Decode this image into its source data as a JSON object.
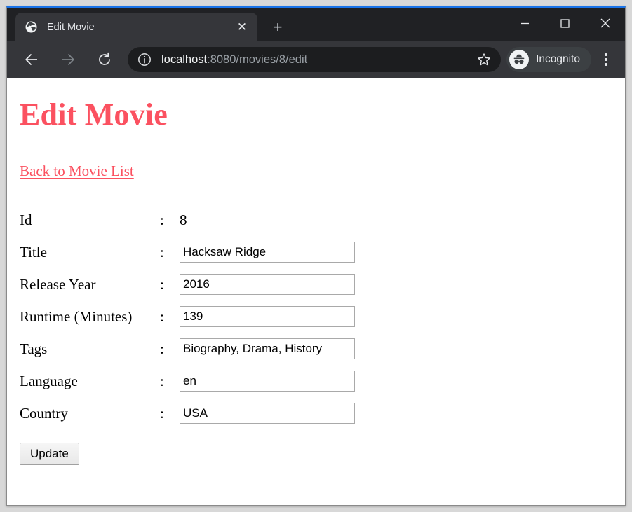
{
  "browser": {
    "tab": {
      "title": "Edit Movie",
      "favicon": "globe-icon",
      "close_label": "✕"
    },
    "new_tab_label": "+",
    "window_controls": {
      "minimize": "minimize-icon",
      "maximize": "maximize-icon",
      "close": "close-icon"
    },
    "toolbar": {
      "back": "back-arrow-icon",
      "forward": "forward-arrow-icon",
      "reload": "reload-icon",
      "site_info": "info-icon",
      "url_host": "localhost",
      "url_rest": ":8080/movies/8/edit",
      "url_full": "localhost:8080/movies/8/edit",
      "bookmark": "star-icon",
      "incognito_label": "Incognito",
      "incognito_icon": "incognito-icon",
      "menu": "kebab-menu-icon"
    }
  },
  "page": {
    "heading": "Edit Movie",
    "back_link": "Back to Movie List",
    "colon": ":",
    "fields": [
      {
        "label": "Id",
        "value": "8",
        "type": "static"
      },
      {
        "label": "Title",
        "value": "Hacksaw Ridge",
        "type": "input"
      },
      {
        "label": "Release Year",
        "value": "2016",
        "type": "input"
      },
      {
        "label": "Runtime (Minutes)",
        "value": "139",
        "type": "input"
      },
      {
        "label": "Tags",
        "value": "Biography, Drama, History",
        "type": "input"
      },
      {
        "label": "Language",
        "value": "en",
        "type": "input"
      },
      {
        "label": "Country",
        "value": "USA",
        "type": "input"
      }
    ],
    "submit_label": "Update"
  },
  "colors": {
    "accent": "#fb5160",
    "chrome_dark": "#202124",
    "toolbar": "#35363a",
    "omnibox": "#1c1d1f",
    "top_border": "#1a73e8"
  }
}
